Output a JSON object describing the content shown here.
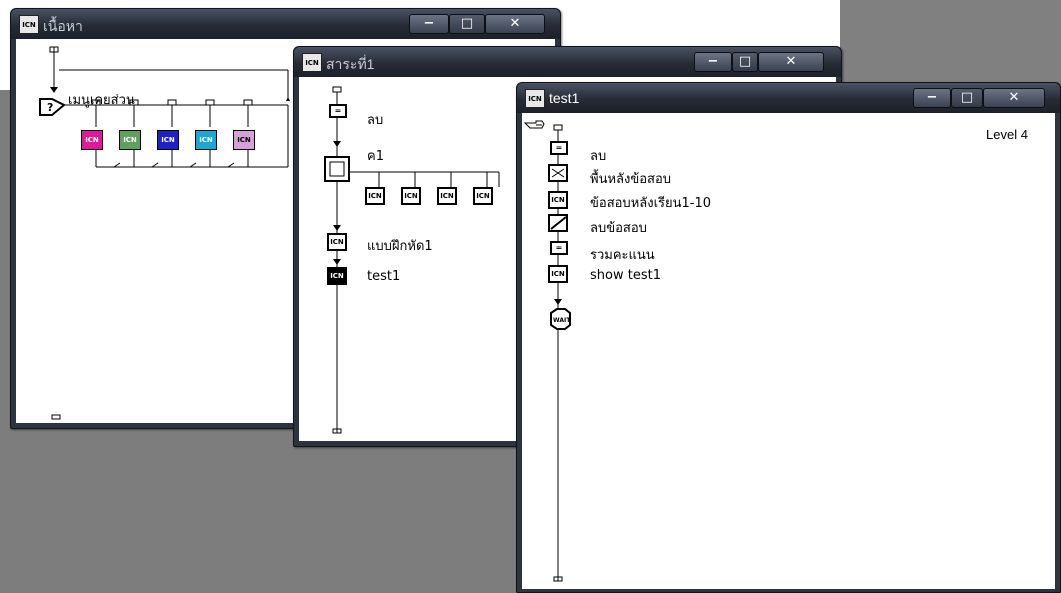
{
  "windows": [
    {
      "id": "content",
      "title": "เนื้อหา",
      "icon_glyph": "ICN",
      "interaction_label": "เมนูเคยส่วน",
      "map_colors": [
        "#e0189a",
        "#5fa05f",
        "#2020c8",
        "#18a8d8",
        "#d8a0d8"
      ]
    },
    {
      "id": "topic1",
      "title": "สาระที่1",
      "icon_glyph": "ICN",
      "items": [
        {
          "label": "ลบ"
        },
        {
          "label": "ค1"
        },
        {
          "label": "แบบฝึกหัด1"
        },
        {
          "label": "test1"
        }
      ]
    },
    {
      "id": "test1",
      "title": "test1",
      "icon_glyph": "ICN",
      "level": "Level 4",
      "items": [
        {
          "label": "ลบ"
        },
        {
          "label": "พื้นหลังข้อสอบ"
        },
        {
          "label": "ข้อสอบหลังเรียน1-10"
        },
        {
          "label": "ลบข้อสอบ"
        },
        {
          "label": "รวมคะแนน"
        },
        {
          "label": "show test1"
        }
      ],
      "wait_label": "WAIT"
    }
  ],
  "controls": {
    "minimize": "−",
    "maximize": "□",
    "close": "✕"
  },
  "glyphs": {
    "calc": "=",
    "decision": "?"
  }
}
